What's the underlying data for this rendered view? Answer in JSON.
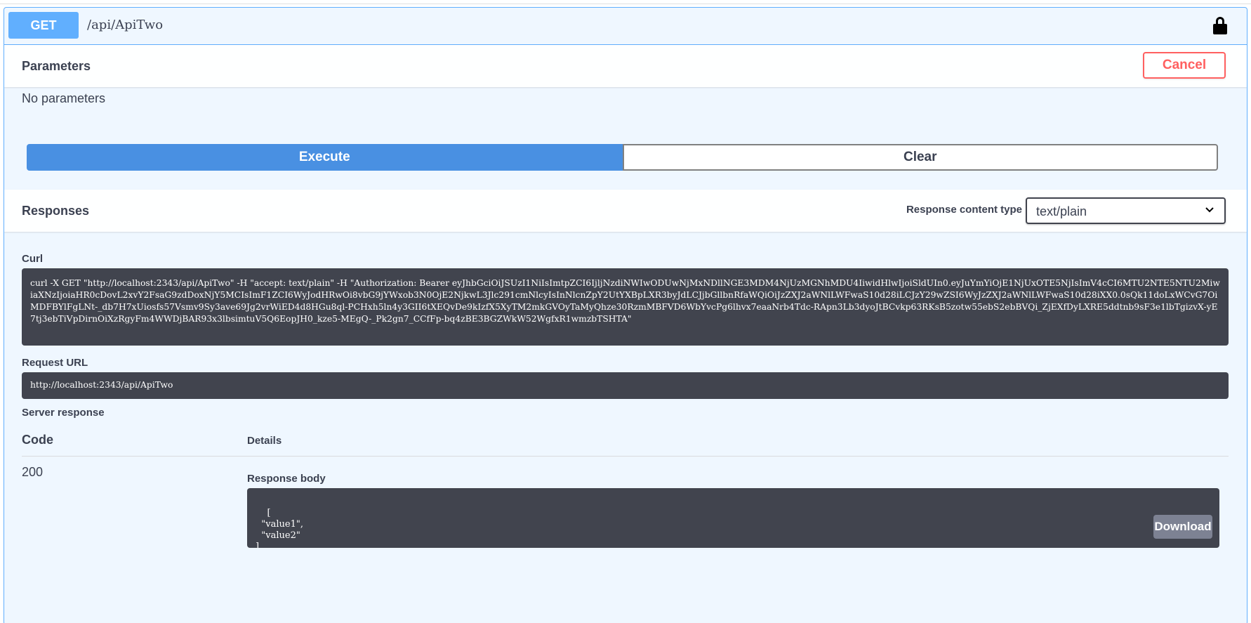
{
  "operation": {
    "method": "GET",
    "path": "/api/ApiTwo",
    "lock_icon": "lock-icon"
  },
  "parameters": {
    "title": "Parameters",
    "cancel_label": "Cancel",
    "empty_text": "No parameters"
  },
  "actions": {
    "execute_label": "Execute",
    "clear_label": "Clear"
  },
  "responses": {
    "title": "Responses",
    "content_type_label": "Response content type",
    "content_type_value": "text/plain"
  },
  "curl": {
    "label": "Curl",
    "command": "curl -X GET \"http://localhost:2343/api/ApiTwo\" -H \"accept: text/plain\" -H \"Authorization: Bearer eyJhbGciOiJSUzI1NiIsImtpZCI6IjljNzdiNWIwODUwNjMxNDllNGE3MDM4NjUzMGNhMDU4IiwidHlwIjoiSldUIn0.eyJuYmYiOjE1NjUxOTE5NjIsImV4cCI6MTU2NTE5NTU2MiwiaXNzIjoiaHR0cDovL2xvY2FsaG9zdDoxNjY5MCIsImF1ZCI6WyJodHRwOi8vbG9jYWxob3N0OjE2NjkwL3Jlc291cmNlcyIsInNlcnZpY2UtYXBpLXR3byJdLCJjbGllbnRfaWQiOiJzZXJ2aWNlLWFwaS10d28iLCJzY29wZSI6WyJzZXJ2aWNlLWFwaS10d28iXX0.0sQk11doLxWCvG7OiMDFBYlFgLNt-_db7H7xUiosfs57Vsmv9Sy3ave69Jg2vrWiED4d8HGu8ql-PCHxh5ln4y3GII6tXEQvDe9kIzfX5XyTM2mkGVOyTaMyQhze30RzmMBFVD6WbYvcPg6lhvx7eaaNrb4Tdc-RApn3Lb3dyoJtBCvkp63RKsB5zotw55ebS2ebBVQi_ZjEXfDyLXRE5ddtnb9sF3e1lbTgizvX-yE7tj3ebTiVpDirnOiXzRgyFm4WWDjBAR93x3lbsimtuV5Q6EopJH0_kze5-MEgQ-_Pk2gn7_CCfFp-bq4zBE3BGZWkW52WgfxR1wmzbTSHTA\""
  },
  "request_url": {
    "label": "Request URL",
    "value": "http://localhost:2343/api/ApiTwo"
  },
  "server_response": {
    "label": "Server response",
    "code_header": "Code",
    "details_header": "Details",
    "code": "200",
    "body_label": "Response body",
    "body": "[\n  \"value1\",\n  \"value2\"\n]",
    "download_label": "Download"
  }
}
